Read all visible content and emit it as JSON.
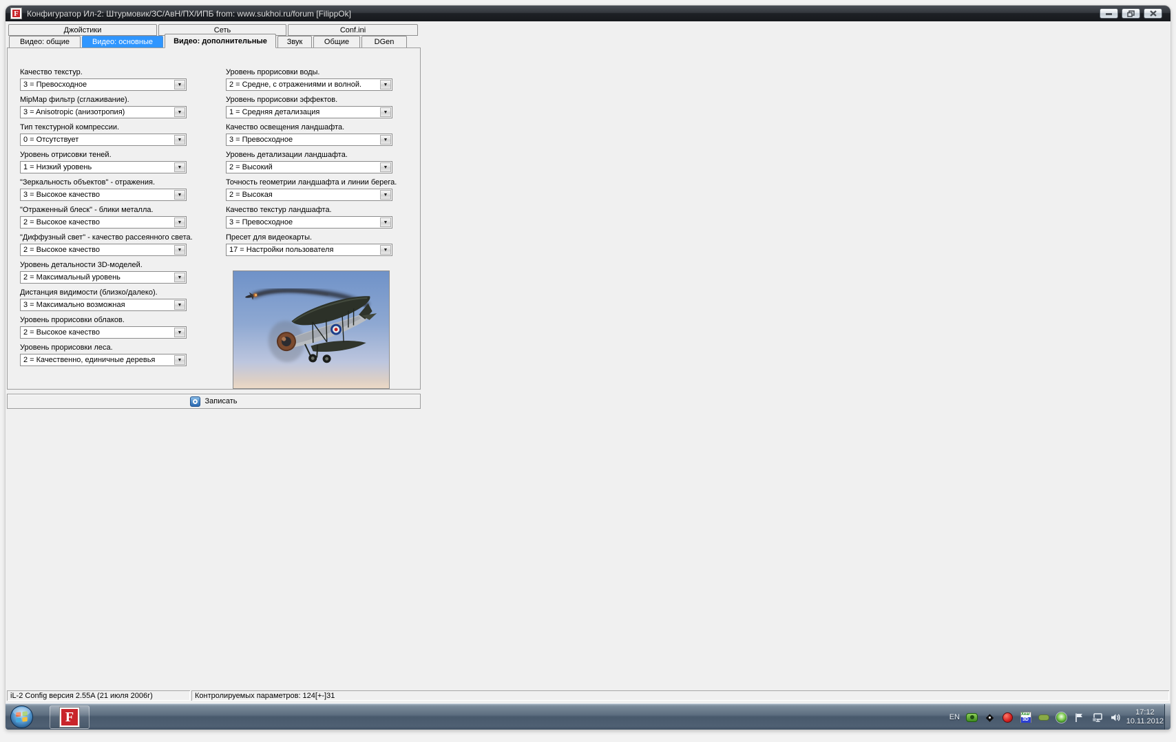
{
  "window": {
    "title": "Конфигуратор Ил-2: Штурмовик/ЗС/АвН/ПХ/ИПБ from: www.sukhoi.ru/forum [FilippOk]",
    "app_icon_letter": "F"
  },
  "tabs_row1": [
    {
      "label": "Джойстики"
    },
    {
      "label": "Сеть"
    },
    {
      "label": "Conf.ini"
    }
  ],
  "tabs_row2": [
    {
      "label": "Видео: общие",
      "state": "normal"
    },
    {
      "label": "Видео: основные",
      "state": "selected"
    },
    {
      "label": "Видео: дополнительные",
      "state": "active"
    },
    {
      "label": "Звук",
      "state": "normal"
    },
    {
      "label": "Общие",
      "state": "normal"
    },
    {
      "label": "DGen",
      "state": "normal"
    }
  ],
  "settings_left": [
    {
      "label": "Качество текстур.",
      "value": "3 = Превосходное"
    },
    {
      "label": "MipMap фильтр (сглаживание).",
      "value": "3 = Anisotropic (анизотропия)"
    },
    {
      "label": "Тип текстурной компрессии.",
      "value": "0 = Отсутствует"
    },
    {
      "label": "Уровень отрисовки теней.",
      "value": "1 = Низкий уровень"
    },
    {
      "label": "\"Зеркальность объектов\" - отражения.",
      "value": "3 = Высокое качество"
    },
    {
      "label": "\"Отраженный блеск\" - блики металла.",
      "value": "2 = Высокое качество"
    },
    {
      "label": "\"Диффузный свет\" - качество рассеянного света.",
      "value": "2 = Высокое качество"
    },
    {
      "label": "Уровень детальности 3D-моделей.",
      "value": "2 = Максимальный уровень"
    },
    {
      "label": "Дистанция видимости (близко/далеко).",
      "value": "3 = Максимально возможная"
    },
    {
      "label": "Уровень прорисовки облаков.",
      "value": "2 = Высокое качество"
    },
    {
      "label": "Уровень прорисовки леса.",
      "value": "2 = Качественно, единичные деревья"
    }
  ],
  "settings_right": [
    {
      "label": "Уровень прорисовки воды.",
      "value": "2 = Средне, с отражениями и волной."
    },
    {
      "label": "Уровень прорисовки эффектов.",
      "value": "1 = Средняя детализация"
    },
    {
      "label": "Качество освещения ландшафта.",
      "value": "3 = Превосходное"
    },
    {
      "label": "Уровень детализации ландшафта.",
      "value": "2 = Высокий"
    },
    {
      "label": "Точность геометрии ландшафта и линии берега.",
      "value": "2 = Высокая"
    },
    {
      "label": "Качество текстур ландшафта.",
      "value": "3 = Превосходное"
    },
    {
      "label": "Пресет для видеокарты.",
      "value": "17 = Настройки пользователя"
    }
  ],
  "preview_image": {
    "description": "биплан в небе, горящий самолёт с дымным следом"
  },
  "save_button": {
    "label": "Записать"
  },
  "status_bar": {
    "left": "iL-2 Config версия 2.55A (21 июля 2006г)",
    "right": "Контролируемых параметров: 124[+-]31"
  },
  "taskbar": {
    "language": "EN",
    "clock": {
      "time": "17:12",
      "date": "10.11.2012"
    },
    "tray_icons": [
      "joystick",
      "diamond",
      "record",
      "xear3d",
      "battery",
      "green-orb",
      "flag",
      "network",
      "volume"
    ]
  },
  "colors": {
    "selected_tab": "#2f96ff",
    "app_icon_red": "#c9252b",
    "titlebar_dark": "#1d2025",
    "client_bg": "#f0f0f0",
    "taskbar_steel": "#48596c"
  }
}
